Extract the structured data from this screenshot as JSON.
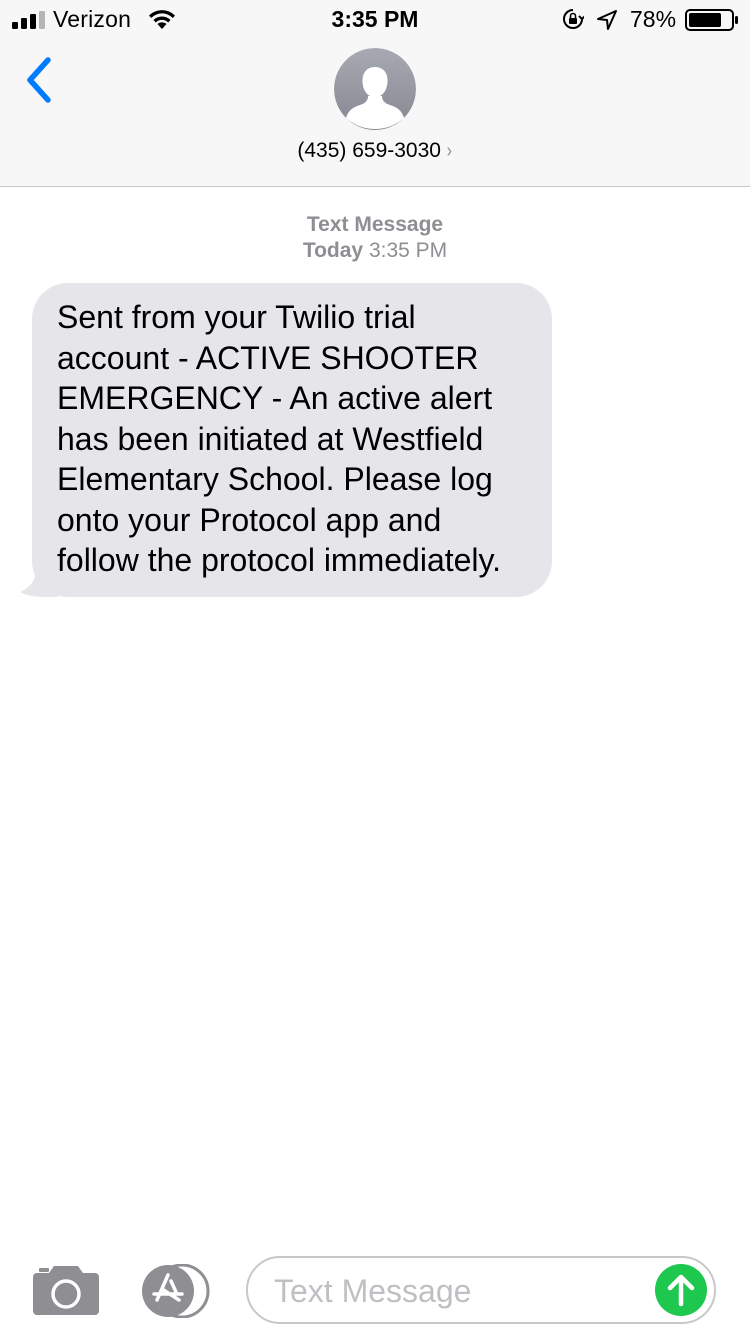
{
  "status_bar": {
    "carrier": "Verizon",
    "time": "3:35 PM",
    "battery_percent": "78%",
    "battery_level": 0.78,
    "icons": [
      "signal-bars-icon",
      "wifi-icon",
      "rotation-lock-icon",
      "location-arrow-icon",
      "battery-icon"
    ]
  },
  "header": {
    "back_icon": "chevron-left-icon",
    "avatar_icon": "person-silhouette-icon",
    "contact_number": "(435) 659-3030",
    "contact_chevron": "›",
    "accent_color": "#007aff"
  },
  "thread": {
    "service_label": "Text Message",
    "day_label": "Today",
    "time_label": "3:35 PM",
    "messages": [
      {
        "direction": "incoming",
        "text": "Sent from your Twilio trial account - ACTIVE SHOOTER EMERGENCY -  An active alert has been initiated at Westfield Elementary School. Please log onto your Protocol app and follow the protocol immediately."
      }
    ]
  },
  "input_bar": {
    "camera_icon": "camera-icon",
    "apps_icon": "app-store-icon",
    "placeholder": "Text Message",
    "value": "",
    "send_icon": "arrow-up-icon",
    "send_color": "#1ec84e"
  }
}
